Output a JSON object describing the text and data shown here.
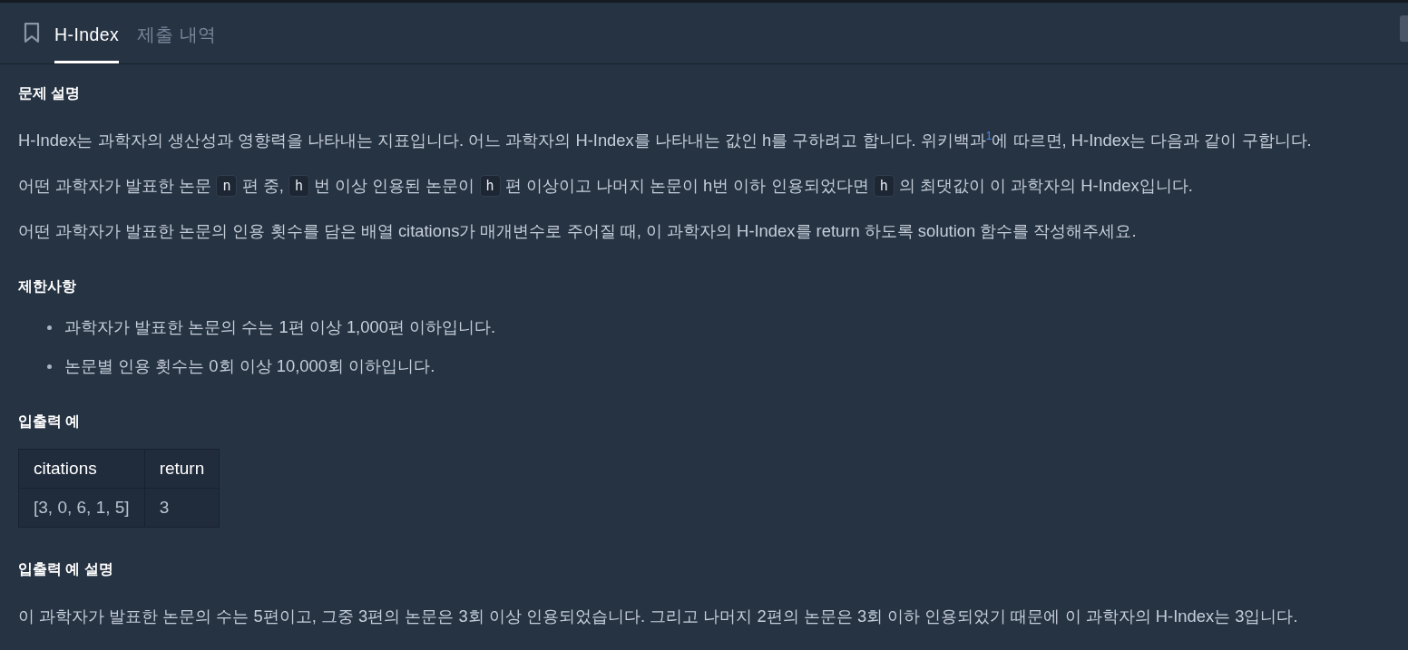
{
  "tabs": [
    {
      "label": "H-Index",
      "selected": true
    },
    {
      "label": "제출 내역",
      "selected": false
    }
  ],
  "sections": [
    {
      "heading": "문제 설명",
      "blocks": [
        {
          "kind": "paragraph",
          "segments": [
            {
              "kind": "text",
              "text": "H-Index는 과학자의 생산성과 영향력을 나타내는 지표입니다. 어느 과학자의 H-Index를 나타내는 값인 h를 구하려고 합니다. 위키백과"
            },
            {
              "kind": "footnote",
              "text": "1"
            },
            {
              "kind": "text",
              "text": "에 따르면, H-Index는 다음과 같이 구합니다."
            }
          ]
        },
        {
          "kind": "paragraph",
          "segments": [
            {
              "kind": "text",
              "text": "어떤 과학자가 발표한 논문 "
            },
            {
              "kind": "code",
              "text": "n"
            },
            {
              "kind": "text",
              "text": " 편 중, "
            },
            {
              "kind": "code",
              "text": "h"
            },
            {
              "kind": "text",
              "text": " 번 이상 인용된 논문이 "
            },
            {
              "kind": "code",
              "text": "h"
            },
            {
              "kind": "text",
              "text": " 편 이상이고 나머지 논문이 h번 이하 인용되었다면 "
            },
            {
              "kind": "code",
              "text": "h"
            },
            {
              "kind": "text",
              "text": " 의 최댓값이 이 과학자의 H-Index입니다."
            }
          ]
        },
        {
          "kind": "paragraph",
          "segments": [
            {
              "kind": "text",
              "text": "어떤 과학자가 발표한 논문의 인용 횟수를 담은 배열 citations가 매개변수로 주어질 때, 이 과학자의 H-Index를 return 하도록 solution 함수를 작성해주세요."
            }
          ]
        }
      ]
    },
    {
      "heading": "제한사항",
      "blocks": [
        {
          "kind": "list",
          "items": [
            "과학자가 발표한 논문의 수는 1편 이상 1,000편 이하입니다.",
            "논문별 인용 횟수는 0회 이상 10,000회 이하입니다."
          ]
        }
      ]
    },
    {
      "heading": "입출력 예",
      "blocks": [
        {
          "kind": "table",
          "columns": [
            "citations",
            "return"
          ],
          "rows": [
            [
              "[3, 0, 6, 1, 5]",
              "3"
            ]
          ]
        }
      ]
    },
    {
      "heading": "입출력 예 설명",
      "blocks": [
        {
          "kind": "paragraph",
          "segments": [
            {
              "kind": "text",
              "text": "이 과학자가 발표한 논문의 수는 5편이고, 그중 3편의 논문은 3회 이상 인용되었습니다. 그리고 나머지 2편의 논문은 3회 이하 인용되었기 때문에 이 과학자의 H-Index는 3입니다."
            }
          ]
        }
      ]
    }
  ]
}
